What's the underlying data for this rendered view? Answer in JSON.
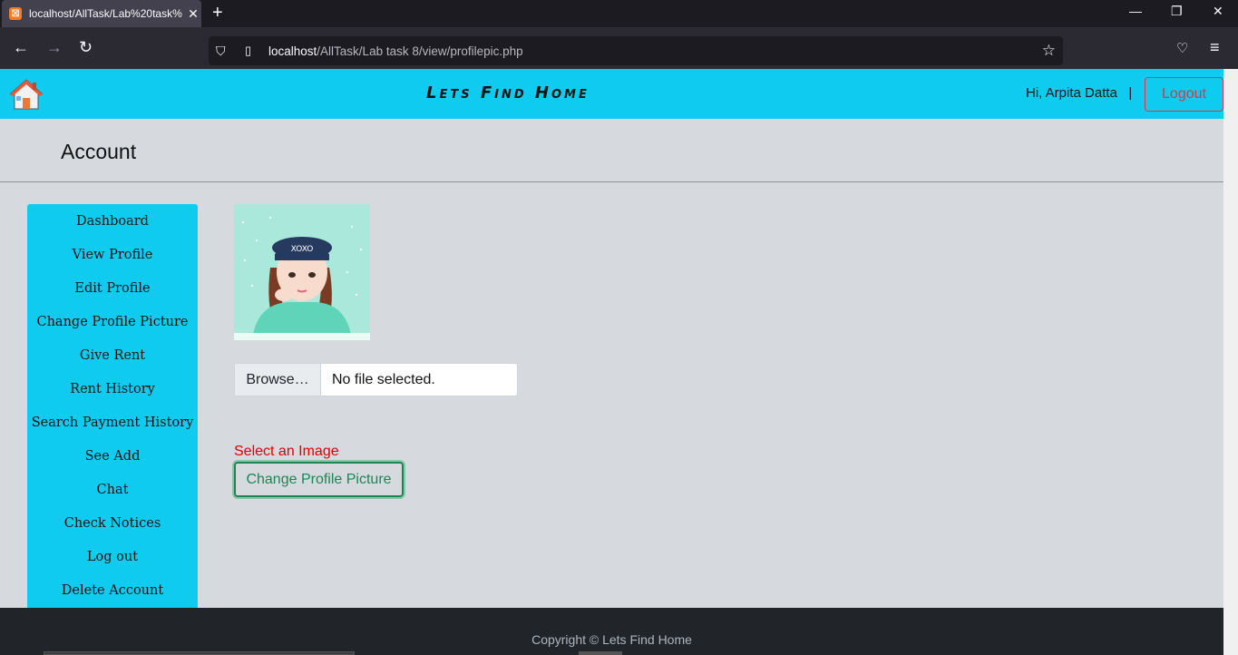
{
  "browser": {
    "tab_title": "localhost/AllTask/Lab%20task%",
    "url_host": "localhost",
    "url_path": "/AllTask/Lab task 8/view/profilepic.php"
  },
  "header": {
    "brand": "Lets Find Home",
    "greeting": "Hi, Arpita Datta",
    "separator": "|",
    "logout_label": "Logout"
  },
  "page_title": "Account",
  "sidebar": {
    "items": [
      {
        "label": "Dashboard"
      },
      {
        "label": "View Profile"
      },
      {
        "label": "Edit Profile"
      },
      {
        "label": "Change Profile Picture"
      },
      {
        "label": "Give Rent"
      },
      {
        "label": "Rent History"
      },
      {
        "label": "Search Payment History"
      },
      {
        "label": "See Add"
      },
      {
        "label": "Chat"
      },
      {
        "label": "Check Notices"
      },
      {
        "label": "Log out"
      },
      {
        "label": "Delete Account"
      }
    ]
  },
  "form": {
    "browse_label": "Browse…",
    "no_file_text": "No file selected.",
    "error_text": "Select an Image",
    "submit_label": "Change Profile Picture"
  },
  "footer": {
    "copyright": "Copyright © Lets Find Home"
  },
  "colors": {
    "header_bg": "#10cbf0",
    "danger": "#dc3545",
    "success": "#198754"
  }
}
